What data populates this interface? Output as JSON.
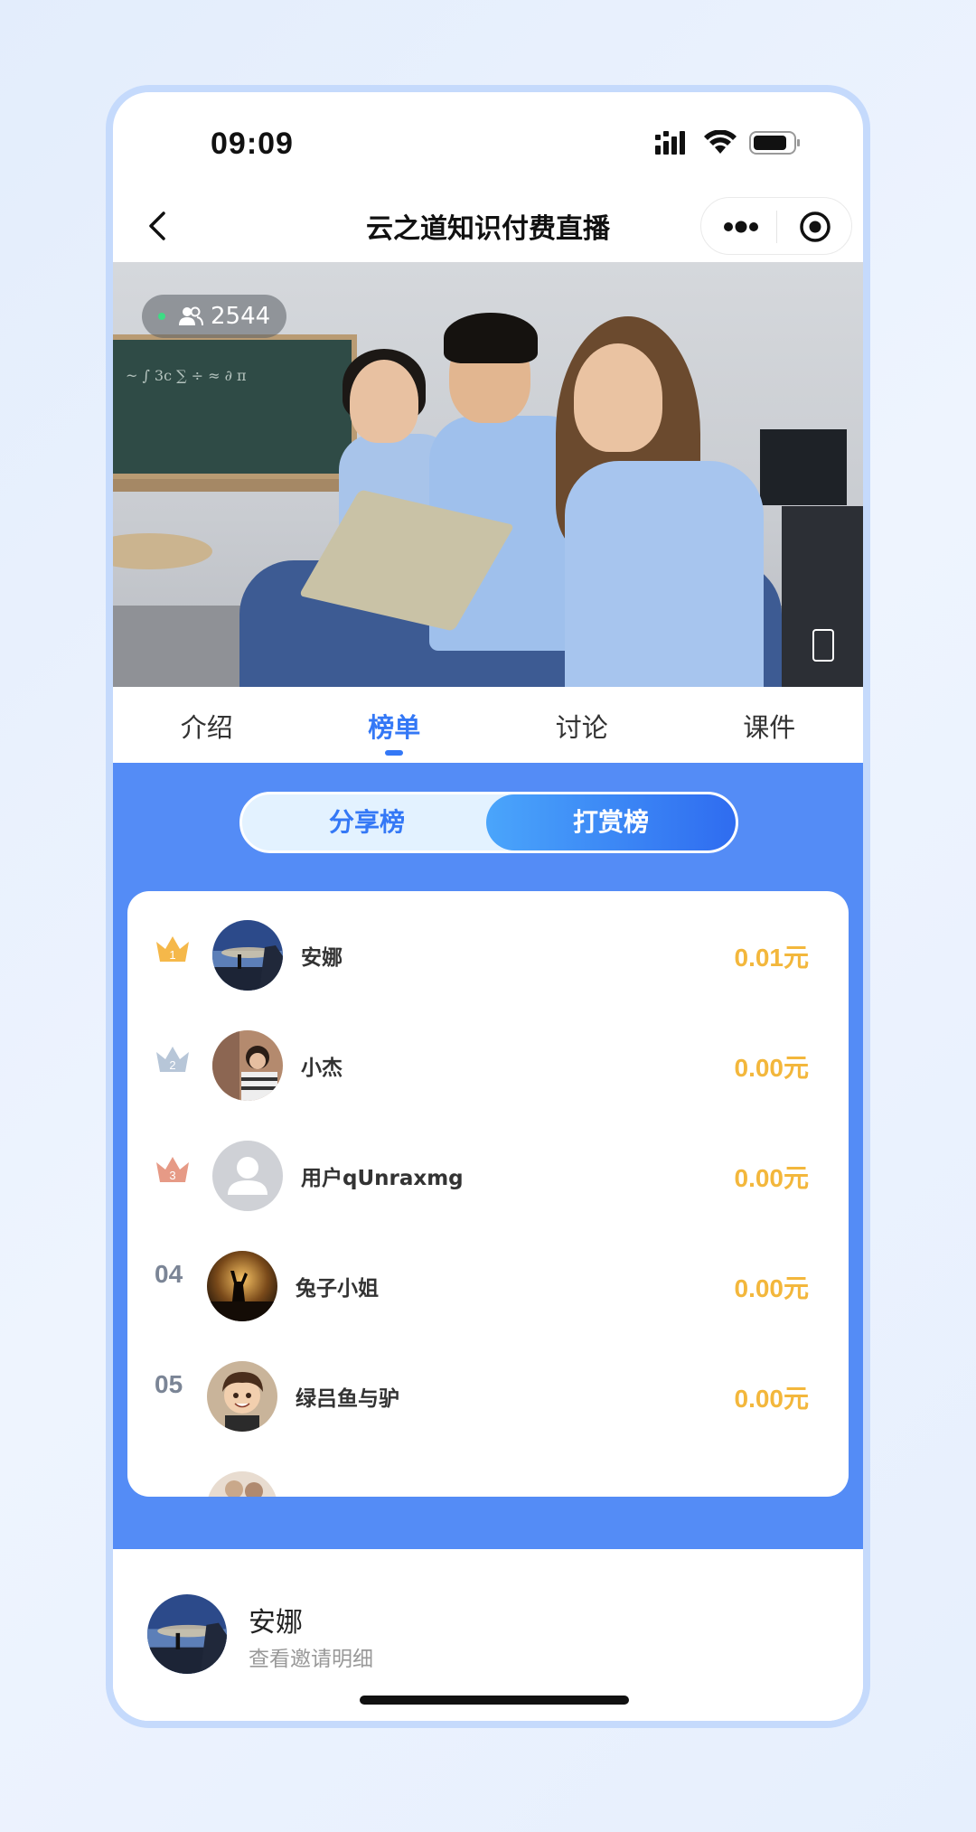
{
  "status_bar": {
    "time": "09:09"
  },
  "nav": {
    "title": "云之道知识付费直播"
  },
  "video": {
    "viewer_count": "2544"
  },
  "tabs": [
    {
      "label": "介绍",
      "active": false
    },
    {
      "label": "榜单",
      "active": true
    },
    {
      "label": "讨论",
      "active": false
    },
    {
      "label": "课件",
      "active": false
    }
  ],
  "segment": {
    "share_label": "分享榜",
    "tip_label": "打赏榜",
    "selected": "打赏榜"
  },
  "ranking": [
    {
      "rank": "1",
      "name": "安娜",
      "amount": "0.01元",
      "avatar": "sunset-cliff"
    },
    {
      "rank": "2",
      "name": "小杰",
      "amount": "0.00元",
      "avatar": "girl-photo"
    },
    {
      "rank": "3",
      "name": "用户qUnraxmg",
      "amount": "0.00元",
      "avatar": "default-user"
    },
    {
      "rank": "04",
      "name": "兔子小姐",
      "amount": "0.00元",
      "avatar": "sunset-silhouette"
    },
    {
      "rank": "05",
      "name": "绿吕鱼与驴",
      "amount": "0.00元",
      "avatar": "cartoon-boy"
    }
  ],
  "me": {
    "name": "安娜",
    "subtitle": "查看邀请明细"
  },
  "colors": {
    "accent": "#3478f6",
    "rank_bg": "#548cf6",
    "amount": "#f3b73c",
    "gold": "#f5b84a",
    "silver": "#b7c6d8",
    "bronze": "#e69a86"
  }
}
